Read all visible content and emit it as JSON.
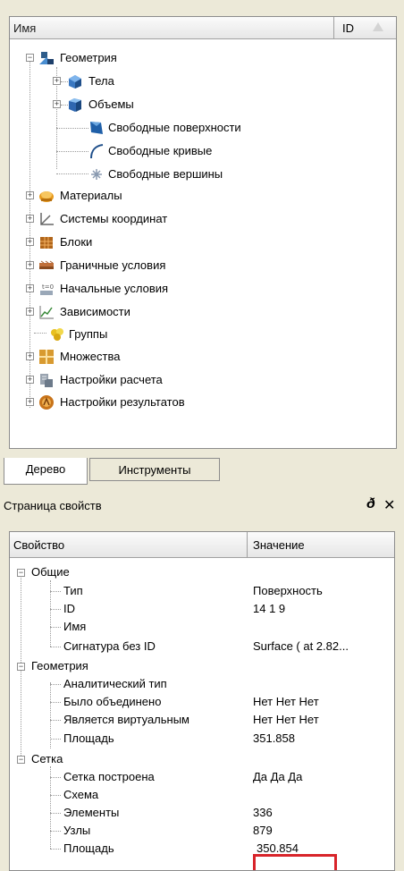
{
  "tree": {
    "header": {
      "name_col": "Имя",
      "id_col": "ID"
    },
    "items": [
      {
        "label": "Геометрия",
        "icon": "geometry-icon"
      },
      {
        "label": "Тела",
        "icon": "bodies-icon"
      },
      {
        "label": "Объемы",
        "icon": "volumes-icon"
      },
      {
        "label": "Свободные поверхности",
        "icon": "free-surfaces-icon"
      },
      {
        "label": "Свободные кривые",
        "icon": "free-curves-icon"
      },
      {
        "label": "Свободные вершины",
        "icon": "free-vertices-icon"
      },
      {
        "label": "Материалы",
        "icon": "materials-icon"
      },
      {
        "label": "Системы координат",
        "icon": "coordinate-systems-icon"
      },
      {
        "label": "Блоки",
        "icon": "blocks-icon"
      },
      {
        "label": "Граничные условия",
        "icon": "boundary-conditions-icon"
      },
      {
        "label": "Начальные условия",
        "icon": "initial-conditions-icon"
      },
      {
        "label": "Зависимости",
        "icon": "dependencies-icon"
      },
      {
        "label": "Группы",
        "icon": "groups-icon"
      },
      {
        "label": "Множества",
        "icon": "sets-icon"
      },
      {
        "label": "Настройки расчета",
        "icon": "calc-settings-icon"
      },
      {
        "label": "Настройки результатов",
        "icon": "results-settings-icon"
      }
    ]
  },
  "tabs": {
    "tree": "Дерево",
    "tools": "Инструменты"
  },
  "props": {
    "title": "Страница свойств",
    "restore_glyph": "ð",
    "close_glyph": "✕",
    "header": {
      "property": "Свойство",
      "value": "Значение"
    },
    "groups": [
      {
        "name": "Общие",
        "rows": [
          {
            "prop": "Тип",
            "value": "Поверхность"
          },
          {
            "prop": "ID",
            "value": "14 1 9"
          },
          {
            "prop": "Имя",
            "value": ""
          },
          {
            "prop": "Сигнатура без ID",
            "value": "Surface ( at 2.82..."
          }
        ]
      },
      {
        "name": "Геометрия",
        "rows": [
          {
            "prop": "Аналитический тип",
            "value": ""
          },
          {
            "prop": "Было объединено",
            "value": "Нет Нет Нет"
          },
          {
            "prop": "Является виртуальным",
            "value": "Нет Нет Нет"
          },
          {
            "prop": "Площадь",
            "value": "351.858"
          }
        ]
      },
      {
        "name": "Сетка",
        "rows": [
          {
            "prop": "Сетка построена",
            "value": "Да Да Да"
          },
          {
            "prop": "Схема",
            "value": ""
          },
          {
            "prop": "Элементы",
            "value": "336"
          },
          {
            "prop": "Узлы",
            "value": "879"
          },
          {
            "prop": "Площадь",
            "value": "350.854"
          }
        ]
      }
    ]
  }
}
